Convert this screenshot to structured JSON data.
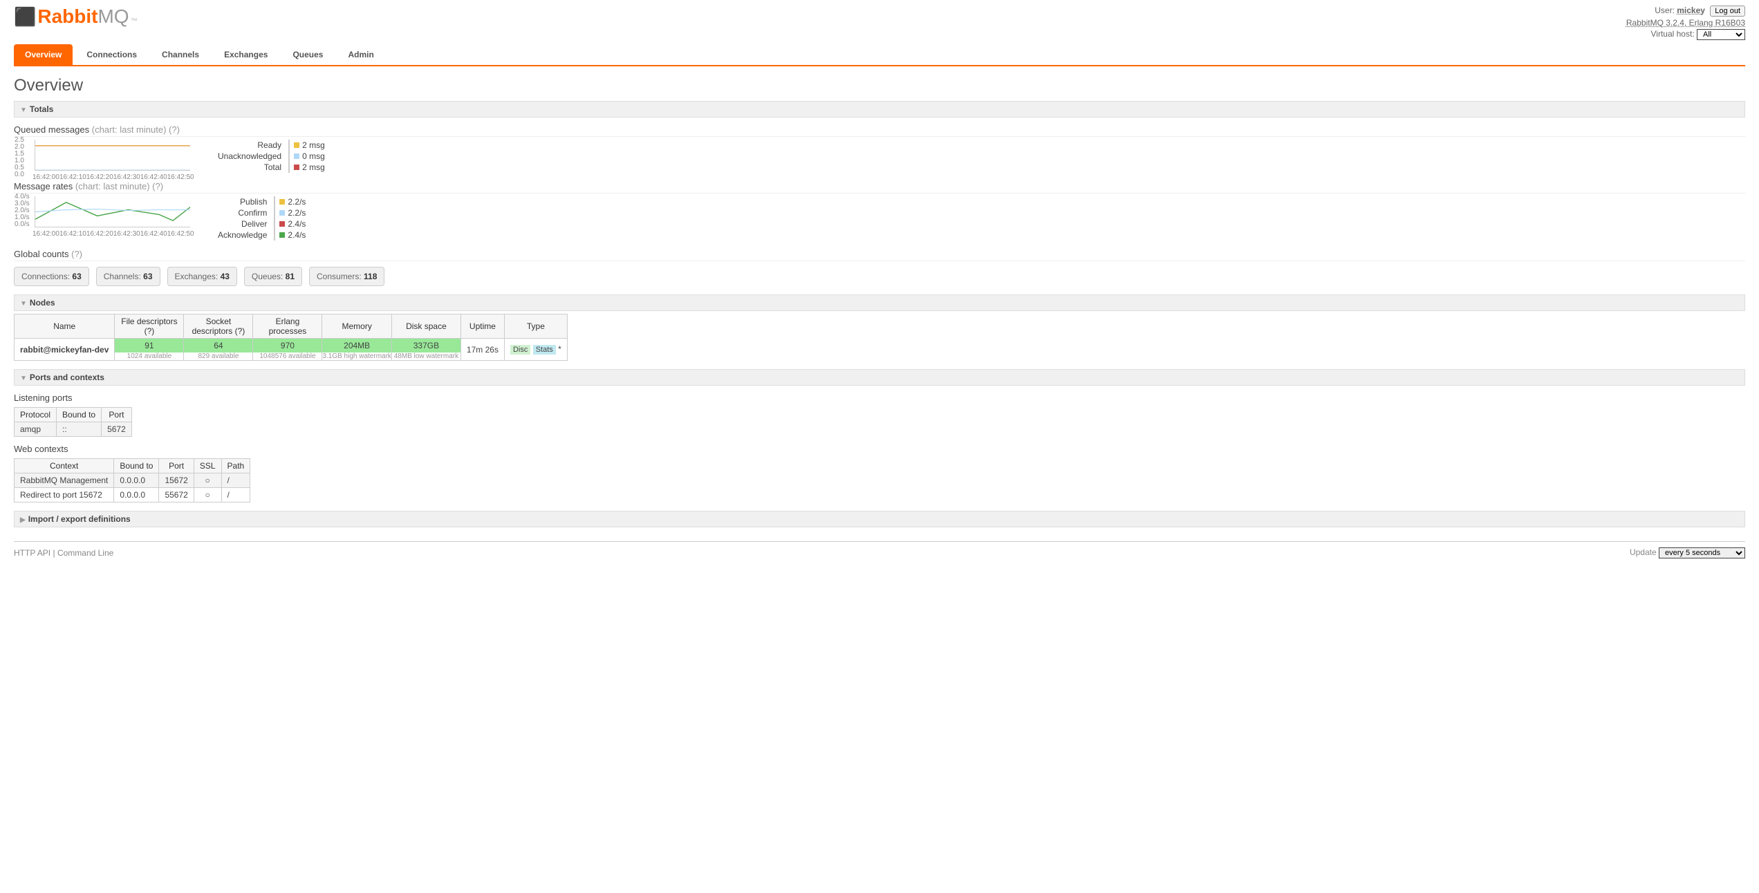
{
  "header": {
    "logo_rabbit": "Rabbit",
    "logo_mq": "MQ",
    "logo_tm": "™",
    "user_label": "User:",
    "username": "mickey",
    "logout": "Log out",
    "version_line": "RabbitMQ 3.2.4, Erlang R16B03",
    "vhost_label": "Virtual host:",
    "vhost_value": "All"
  },
  "tabs": [
    "Overview",
    "Connections",
    "Channels",
    "Exchanges",
    "Queues",
    "Admin"
  ],
  "page_title": "Overview",
  "sections": {
    "totals": "Totals",
    "nodes": "Nodes",
    "ports": "Ports and contexts",
    "import": "Import / export definitions"
  },
  "queued": {
    "title": "Queued messages",
    "hint": "(chart: last minute) (?)",
    "legend": [
      {
        "label": "Ready",
        "value": "2 msg",
        "color": "#edc240"
      },
      {
        "label": "Unacknowledged",
        "value": "0 msg",
        "color": "#afd8f8"
      },
      {
        "label": "Total",
        "value": "2 msg",
        "color": "#cb4b4b"
      }
    ]
  },
  "rates": {
    "title": "Message rates",
    "hint": "(chart: last minute) (?)",
    "legend": [
      {
        "label": "Publish",
        "value": "2.2/s",
        "color": "#edc240"
      },
      {
        "label": "Confirm",
        "value": "2.2/s",
        "color": "#afd8f8"
      },
      {
        "label": "Deliver",
        "value": "2.4/s",
        "color": "#cb4b4b"
      },
      {
        "label": "Acknowledge",
        "value": "2.4/s",
        "color": "#4da74d"
      }
    ]
  },
  "global_counts": {
    "title": "Global counts",
    "hint": "(?)",
    "items": [
      {
        "label": "Connections:",
        "value": "63"
      },
      {
        "label": "Channels:",
        "value": "63"
      },
      {
        "label": "Exchanges:",
        "value": "43"
      },
      {
        "label": "Queues:",
        "value": "81"
      },
      {
        "label": "Consumers:",
        "value": "118"
      }
    ]
  },
  "nodes_table": {
    "headers": [
      "Name",
      "File descriptors (?)",
      "Socket descriptors (?)",
      "Erlang processes",
      "Memory",
      "Disk space",
      "Uptime",
      "Type"
    ],
    "row": {
      "name": "rabbit@mickeyfan-dev",
      "fd": "91",
      "fd_sub": "1024 available",
      "sd": "64",
      "sd_sub": "829 available",
      "ep": "970",
      "ep_sub": "1048576 available",
      "mem": "204MB",
      "mem_sub": "3.1GB high watermark",
      "disk": "337GB",
      "disk_sub": "48MB low watermark",
      "uptime": "17m 26s",
      "type1": "Disc",
      "type2": "Stats",
      "type3": "*"
    }
  },
  "ports": {
    "listening_title": "Listening ports",
    "listen_headers": [
      "Protocol",
      "Bound to",
      "Port"
    ],
    "listen_row": {
      "proto": "amqp",
      "bound": "::",
      "port": "5672"
    },
    "web_title": "Web contexts",
    "web_headers": [
      "Context",
      "Bound to",
      "Port",
      "SSL",
      "Path"
    ],
    "web_rows": [
      {
        "ctx": "RabbitMQ Management",
        "bound": "0.0.0.0",
        "port": "15672",
        "ssl": "○",
        "path": "/"
      },
      {
        "ctx": "Redirect to port 15672",
        "bound": "0.0.0.0",
        "port": "55672",
        "ssl": "○",
        "path": "/"
      }
    ]
  },
  "footer": {
    "http_api": "HTTP API",
    "cli": "Command Line",
    "update_label": "Update",
    "update_value": "every 5 seconds"
  },
  "chart_data": [
    {
      "type": "line",
      "title": "Queued messages (last minute)",
      "x": [
        "16:42:00",
        "16:42:10",
        "16:42:20",
        "16:42:30",
        "16:42:40",
        "16:42:50"
      ],
      "ylim": [
        0,
        2.5
      ],
      "y_ticks": [
        "2.5",
        "2.0",
        "1.5",
        "1.0",
        "0.5",
        "0.0"
      ],
      "series": [
        {
          "name": "Ready",
          "color": "#edc240",
          "values": [
            2,
            2,
            2,
            2,
            2,
            2
          ]
        },
        {
          "name": "Unacknowledged",
          "color": "#afd8f8",
          "values": [
            0,
            0,
            0,
            0,
            0,
            0
          ]
        },
        {
          "name": "Total",
          "color": "#cb4b4b",
          "values": [
            2,
            2,
            2,
            2,
            2,
            2
          ]
        }
      ]
    },
    {
      "type": "line",
      "title": "Message rates (last minute)",
      "x": [
        "16:42:00",
        "16:42:10",
        "16:42:20",
        "16:42:30",
        "16:42:40",
        "16:42:50"
      ],
      "ylim": [
        0,
        4
      ],
      "y_ticks": [
        "4.0/s",
        "3.0/s",
        "2.0/s",
        "1.0/s",
        "0.0/s"
      ],
      "series": [
        {
          "name": "Publish",
          "color": "#edc240",
          "values": [
            2.0,
            2.2,
            2.3,
            2.1,
            2.2,
            2.2
          ]
        },
        {
          "name": "Confirm",
          "color": "#afd8f8",
          "values": [
            2.0,
            2.2,
            2.3,
            2.1,
            2.2,
            2.2
          ]
        },
        {
          "name": "Deliver",
          "color": "#cb4b4b",
          "values": [
            1.0,
            3.2,
            1.4,
            2.2,
            1.6,
            0.8
          ]
        },
        {
          "name": "Acknowledge",
          "color": "#4da74d",
          "values": [
            1.0,
            3.2,
            1.4,
            2.2,
            1.6,
            0.8
          ]
        }
      ]
    }
  ]
}
